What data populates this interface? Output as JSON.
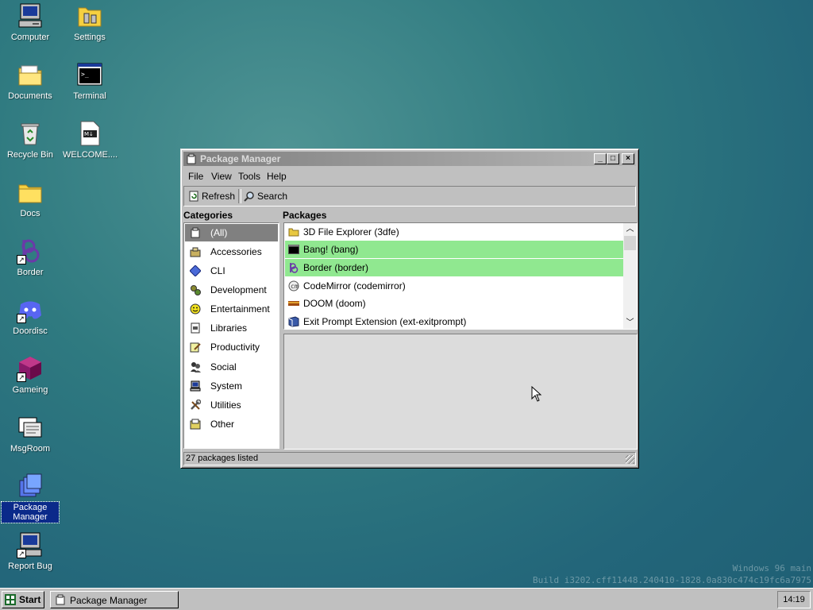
{
  "desktop_icons": [
    {
      "label": "Computer",
      "icon": "computer-icon"
    },
    {
      "label": "Settings",
      "icon": "settings-icon"
    },
    {
      "label": "Documents",
      "icon": "folder-icon"
    },
    {
      "label": "Terminal",
      "icon": "terminal-icon"
    },
    {
      "label": "Recycle Bin",
      "icon": "recycle-bin-icon"
    },
    {
      "label": "WELCOME....",
      "icon": "markdown-file-icon"
    },
    {
      "label": "Docs",
      "icon": "folder-icon"
    },
    {
      "label": "Border",
      "icon": "border-icon"
    },
    {
      "label": "Doordisc",
      "icon": "discord-icon"
    },
    {
      "label": "Gameing",
      "icon": "cube-icon"
    },
    {
      "label": "MsgRoom",
      "icon": "msgroom-icon"
    },
    {
      "label": "Package Manager",
      "icon": "package-manager-icon",
      "selected": true
    },
    {
      "label": "Report Bug",
      "icon": "report-bug-icon"
    }
  ],
  "window": {
    "title": "Package Manager",
    "menu": [
      "File",
      "View",
      "Tools",
      "Help"
    ],
    "toolbar": {
      "refresh": "Refresh",
      "search": "Search"
    },
    "categories_header": "Categories",
    "packages_header": "Packages",
    "categories": [
      {
        "label": "(All)",
        "icon": "all-icon",
        "selected": true
      },
      {
        "label": "Accessories",
        "icon": "accessories-icon"
      },
      {
        "label": "CLI",
        "icon": "cli-icon"
      },
      {
        "label": "Development",
        "icon": "development-icon"
      },
      {
        "label": "Entertainment",
        "icon": "smiley-icon"
      },
      {
        "label": "Libraries",
        "icon": "libraries-icon"
      },
      {
        "label": "Productivity",
        "icon": "productivity-icon"
      },
      {
        "label": "Social",
        "icon": "social-icon"
      },
      {
        "label": "System",
        "icon": "system-icon"
      },
      {
        "label": "Utilities",
        "icon": "utilities-icon"
      },
      {
        "label": "Other",
        "icon": "other-icon"
      }
    ],
    "packages": [
      {
        "label": "3D File Explorer (3dfe)",
        "icon": "folder-icon",
        "highlighted": false
      },
      {
        "label": "Bang! (bang)",
        "icon": "terminal-icon",
        "highlighted": true
      },
      {
        "label": "Border (border)",
        "icon": "border-icon",
        "highlighted": true
      },
      {
        "label": "CodeMirror (codemirror)",
        "icon": "codemirror-icon",
        "highlighted": false
      },
      {
        "label": "DOOM (doom)",
        "icon": "doom-icon",
        "highlighted": false
      },
      {
        "label": "Exit Prompt Extension (ext-exitprompt)",
        "icon": "extension-icon",
        "highlighted": false
      }
    ],
    "status": "27 packages listed"
  },
  "taskbar": {
    "start_label": "Start",
    "task_label": "Package Manager",
    "clock": "14:19"
  },
  "watermark": {
    "line1": "Windows 96 main",
    "line2": "Build i3202.cff11448.240410-1828.0a830c474c19fc6a7975"
  },
  "colors": {
    "highlight": "#90e890",
    "titlebar": "#808080",
    "selection": "#0b2a8a",
    "desktop": "#2f7a80"
  }
}
